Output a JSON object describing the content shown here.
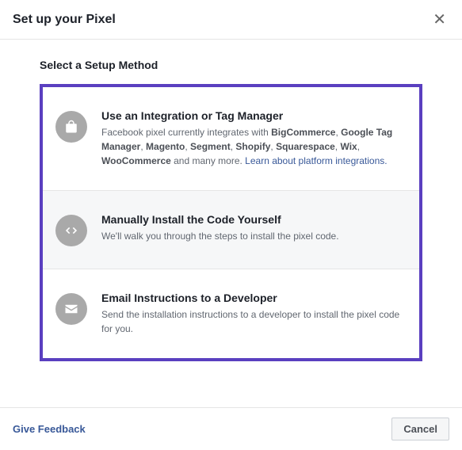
{
  "header": {
    "title": "Set up your Pixel"
  },
  "section_title": "Select a Setup Method",
  "options": {
    "integration": {
      "title": "Use an Integration or Tag Manager",
      "desc_prefix": "Facebook pixel currently integrates with ",
      "platforms": [
        "BigCommerce",
        "Google Tag Manager",
        "Magento",
        "Segment",
        "Shopify",
        "Squarespace",
        "Wix",
        "WooCommerce"
      ],
      "desc_suffix": " and many more. ",
      "link": "Learn about platform integrations."
    },
    "manual": {
      "title": "Manually Install the Code Yourself",
      "desc": "We'll walk you through the steps to install the pixel code."
    },
    "email": {
      "title": "Email Instructions to a Developer",
      "desc": "Send the installation instructions to a developer to install the pixel code for you."
    }
  },
  "footer": {
    "feedback": "Give Feedback",
    "cancel": "Cancel"
  }
}
